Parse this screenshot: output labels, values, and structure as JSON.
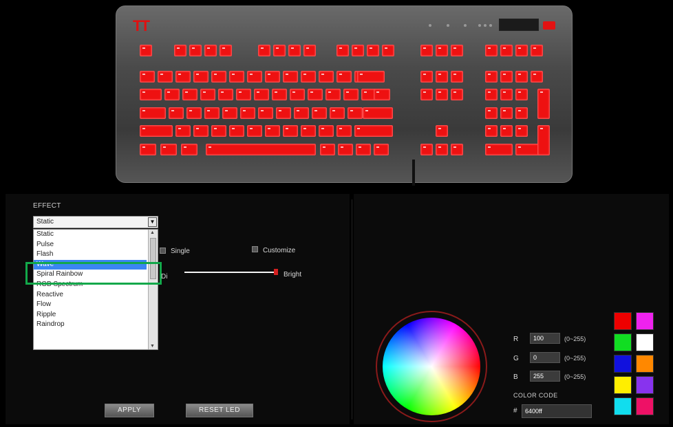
{
  "keyboard": {
    "brand_logo": "TT",
    "key_color": "#ee1111"
  },
  "effect": {
    "label": "EFFECT",
    "selected_value": "Static",
    "options": [
      "Static",
      "Pulse",
      "Flash",
      "Wave",
      "Spiral Rainbow",
      "RGB Spectrum",
      "Reactive",
      "Flow",
      "Ripple",
      "Raindrop"
    ],
    "highlighted_option": "Wave"
  },
  "options": {
    "single_label": "Single",
    "customize_label": "Customize",
    "dim_label": "Dim",
    "bright_label": "Bright",
    "brightness_level": 1.0
  },
  "buttons": {
    "apply": "APPLY",
    "reset_led": "RESET LED"
  },
  "color": {
    "r_label": "R",
    "g_label": "G",
    "b_label": "B",
    "r_value": "100",
    "g_value": "0",
    "b_value": "255",
    "range": "(0~255)",
    "code_label": "COLOR CODE",
    "hash": "#",
    "hex_value": "6400ff",
    "swatches": [
      "#ee0000",
      "#ee22ee",
      "#11dd22",
      "#ffffff",
      "#1111dd",
      "#ff8800",
      "#ffee00",
      "#8833ee",
      "#11ddee",
      "#ee1166"
    ]
  }
}
